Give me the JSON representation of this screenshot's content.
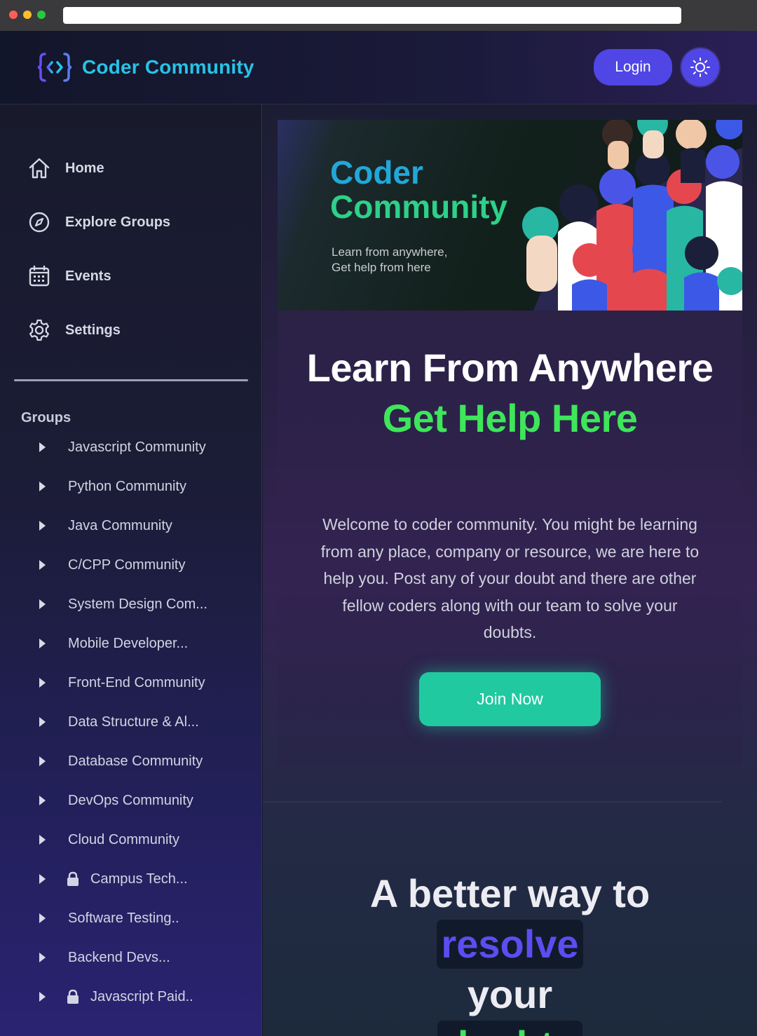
{
  "header": {
    "brand": "Coder Community",
    "login_label": "Login",
    "theme_toggle_icon": "sun-icon"
  },
  "sidebar": {
    "nav": [
      {
        "label": "Home",
        "icon": "home-icon"
      },
      {
        "label": "Explore Groups",
        "icon": "compass-icon"
      },
      {
        "label": "Events",
        "icon": "calendar-icon"
      },
      {
        "label": "Settings",
        "icon": "gear-icon"
      }
    ],
    "groups_title": "Groups",
    "groups": [
      {
        "label": "Javascript Community",
        "locked": false
      },
      {
        "label": "Python Community",
        "locked": false
      },
      {
        "label": "Java Community",
        "locked": false
      },
      {
        "label": "C/CPP Community",
        "locked": false
      },
      {
        "label": "System Design Com...",
        "locked": false
      },
      {
        "label": "Mobile Developer...",
        "locked": false
      },
      {
        "label": "Front-End Community",
        "locked": false
      },
      {
        "label": "Data Structure & Al...",
        "locked": false
      },
      {
        "label": "Database Community",
        "locked": false
      },
      {
        "label": "DevOps Community",
        "locked": false
      },
      {
        "label": "Cloud Community",
        "locked": false
      },
      {
        "label": "Campus Tech...",
        "locked": true
      },
      {
        "label": "Software Testing..",
        "locked": false
      },
      {
        "label": "Backend Devs...",
        "locked": false
      },
      {
        "label": "Javascript Paid..",
        "locked": true
      }
    ]
  },
  "banner": {
    "title_line1": "Coder",
    "title_line2": "Community",
    "subtitle_line1": "Learn from anywhere,",
    "subtitle_line2": "Get help from here"
  },
  "hero": {
    "heading_part1": "Learn From Anywhere ",
    "heading_accent": "Get Help Here",
    "description": "Welcome to coder community. You might be learning from any place, company or resource, we are here to help you. Post any of your doubt and there are other fellow coders along with our team to solve your doubts.",
    "cta_label": "Join Now"
  },
  "section2": {
    "line1": "A better way to",
    "chip_word": "resolve",
    "line3": "your",
    "chip_word2": "doubts"
  },
  "colors": {
    "brand": "#27c3e6",
    "accent_green": "#3ee65a",
    "primary": "#4f46e5",
    "cta": "#20c9a0"
  }
}
